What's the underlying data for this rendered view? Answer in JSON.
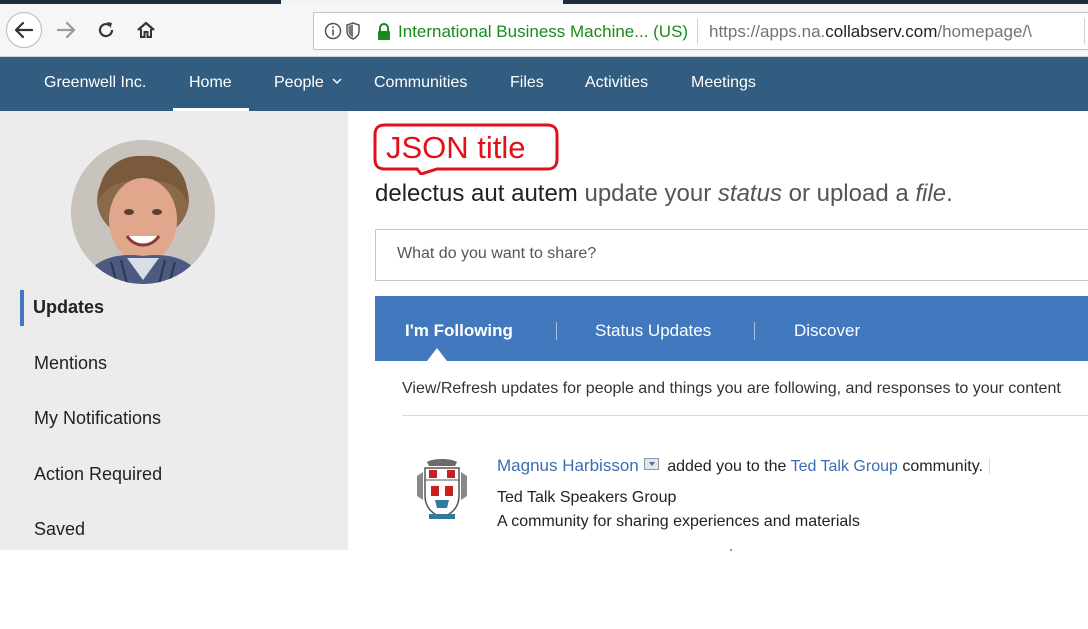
{
  "browser": {
    "identity": "International Business Machine...  (US)",
    "url_prefix": "https://apps.na.",
    "url_host": "collabserv.com",
    "url_suffix": "/homepage/\\"
  },
  "appnav": {
    "items": [
      {
        "label": "Greenwell Inc."
      },
      {
        "label": "Home"
      },
      {
        "label": "People"
      },
      {
        "label": "Communities"
      },
      {
        "label": "Files"
      },
      {
        "label": "Activities"
      },
      {
        "label": "Meetings"
      }
    ],
    "active": "Home"
  },
  "sidebar": {
    "items": [
      {
        "label": "Updates"
      },
      {
        "label": "Mentions"
      },
      {
        "label": "My Notifications"
      },
      {
        "label": "Action Required"
      },
      {
        "label": "Saved"
      }
    ],
    "active": "Updates"
  },
  "annotation": {
    "text": "JSON title"
  },
  "greeting": {
    "name": "delectus aut autem",
    "part1": " update your ",
    "status_word": "status",
    "part2": " or upload a ",
    "file_word": "file",
    "end": "."
  },
  "share": {
    "placeholder": "What do you want to share?"
  },
  "tabs": {
    "items": [
      {
        "label": "I'm Following"
      },
      {
        "label": "Status Updates"
      },
      {
        "label": "Discover"
      }
    ],
    "active": "I'm Following",
    "description": "View/Refresh updates for people and things you are following, and responses to your content"
  },
  "entry": {
    "actor": "Magnus Harbisson",
    "action1": " added you to the ",
    "community_link": "Ted Talk Group",
    "action2": " community.",
    "title": "Ted Talk Speakers Group",
    "summary": "A community for sharing experiences and materials"
  },
  "colors": {
    "nav_bg": "#325c80",
    "tabs_bg": "#4178be",
    "link": "#3b6db5",
    "secure_green": "#1a8a1f",
    "annotation_red": "#e3101a"
  }
}
